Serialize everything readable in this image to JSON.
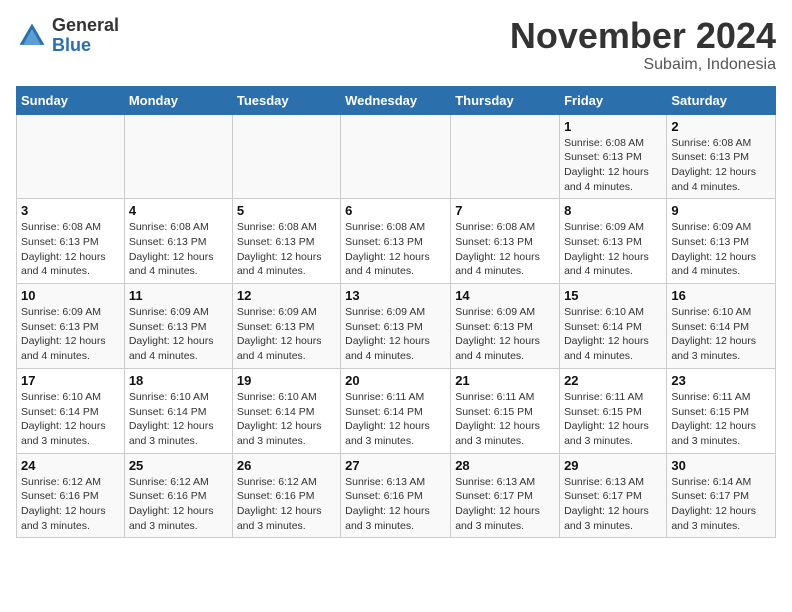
{
  "logo": {
    "general": "General",
    "blue": "Blue"
  },
  "header": {
    "month": "November 2024",
    "location": "Subaim, Indonesia"
  },
  "weekdays": [
    "Sunday",
    "Monday",
    "Tuesday",
    "Wednesday",
    "Thursday",
    "Friday",
    "Saturday"
  ],
  "weeks": [
    [
      {
        "day": "",
        "info": ""
      },
      {
        "day": "",
        "info": ""
      },
      {
        "day": "",
        "info": ""
      },
      {
        "day": "",
        "info": ""
      },
      {
        "day": "",
        "info": ""
      },
      {
        "day": "1",
        "info": "Sunrise: 6:08 AM\nSunset: 6:13 PM\nDaylight: 12 hours and 4 minutes."
      },
      {
        "day": "2",
        "info": "Sunrise: 6:08 AM\nSunset: 6:13 PM\nDaylight: 12 hours and 4 minutes."
      }
    ],
    [
      {
        "day": "3",
        "info": "Sunrise: 6:08 AM\nSunset: 6:13 PM\nDaylight: 12 hours and 4 minutes."
      },
      {
        "day": "4",
        "info": "Sunrise: 6:08 AM\nSunset: 6:13 PM\nDaylight: 12 hours and 4 minutes."
      },
      {
        "day": "5",
        "info": "Sunrise: 6:08 AM\nSunset: 6:13 PM\nDaylight: 12 hours and 4 minutes."
      },
      {
        "day": "6",
        "info": "Sunrise: 6:08 AM\nSunset: 6:13 PM\nDaylight: 12 hours and 4 minutes."
      },
      {
        "day": "7",
        "info": "Sunrise: 6:08 AM\nSunset: 6:13 PM\nDaylight: 12 hours and 4 minutes."
      },
      {
        "day": "8",
        "info": "Sunrise: 6:09 AM\nSunset: 6:13 PM\nDaylight: 12 hours and 4 minutes."
      },
      {
        "day": "9",
        "info": "Sunrise: 6:09 AM\nSunset: 6:13 PM\nDaylight: 12 hours and 4 minutes."
      }
    ],
    [
      {
        "day": "10",
        "info": "Sunrise: 6:09 AM\nSunset: 6:13 PM\nDaylight: 12 hours and 4 minutes."
      },
      {
        "day": "11",
        "info": "Sunrise: 6:09 AM\nSunset: 6:13 PM\nDaylight: 12 hours and 4 minutes."
      },
      {
        "day": "12",
        "info": "Sunrise: 6:09 AM\nSunset: 6:13 PM\nDaylight: 12 hours and 4 minutes."
      },
      {
        "day": "13",
        "info": "Sunrise: 6:09 AM\nSunset: 6:13 PM\nDaylight: 12 hours and 4 minutes."
      },
      {
        "day": "14",
        "info": "Sunrise: 6:09 AM\nSunset: 6:13 PM\nDaylight: 12 hours and 4 minutes."
      },
      {
        "day": "15",
        "info": "Sunrise: 6:10 AM\nSunset: 6:14 PM\nDaylight: 12 hours and 4 minutes."
      },
      {
        "day": "16",
        "info": "Sunrise: 6:10 AM\nSunset: 6:14 PM\nDaylight: 12 hours and 3 minutes."
      }
    ],
    [
      {
        "day": "17",
        "info": "Sunrise: 6:10 AM\nSunset: 6:14 PM\nDaylight: 12 hours and 3 minutes."
      },
      {
        "day": "18",
        "info": "Sunrise: 6:10 AM\nSunset: 6:14 PM\nDaylight: 12 hours and 3 minutes."
      },
      {
        "day": "19",
        "info": "Sunrise: 6:10 AM\nSunset: 6:14 PM\nDaylight: 12 hours and 3 minutes."
      },
      {
        "day": "20",
        "info": "Sunrise: 6:11 AM\nSunset: 6:14 PM\nDaylight: 12 hours and 3 minutes."
      },
      {
        "day": "21",
        "info": "Sunrise: 6:11 AM\nSunset: 6:15 PM\nDaylight: 12 hours and 3 minutes."
      },
      {
        "day": "22",
        "info": "Sunrise: 6:11 AM\nSunset: 6:15 PM\nDaylight: 12 hours and 3 minutes."
      },
      {
        "day": "23",
        "info": "Sunrise: 6:11 AM\nSunset: 6:15 PM\nDaylight: 12 hours and 3 minutes."
      }
    ],
    [
      {
        "day": "24",
        "info": "Sunrise: 6:12 AM\nSunset: 6:16 PM\nDaylight: 12 hours and 3 minutes."
      },
      {
        "day": "25",
        "info": "Sunrise: 6:12 AM\nSunset: 6:16 PM\nDaylight: 12 hours and 3 minutes."
      },
      {
        "day": "26",
        "info": "Sunrise: 6:12 AM\nSunset: 6:16 PM\nDaylight: 12 hours and 3 minutes."
      },
      {
        "day": "27",
        "info": "Sunrise: 6:13 AM\nSunset: 6:16 PM\nDaylight: 12 hours and 3 minutes."
      },
      {
        "day": "28",
        "info": "Sunrise: 6:13 AM\nSunset: 6:17 PM\nDaylight: 12 hours and 3 minutes."
      },
      {
        "day": "29",
        "info": "Sunrise: 6:13 AM\nSunset: 6:17 PM\nDaylight: 12 hours and 3 minutes."
      },
      {
        "day": "30",
        "info": "Sunrise: 6:14 AM\nSunset: 6:17 PM\nDaylight: 12 hours and 3 minutes."
      }
    ]
  ]
}
